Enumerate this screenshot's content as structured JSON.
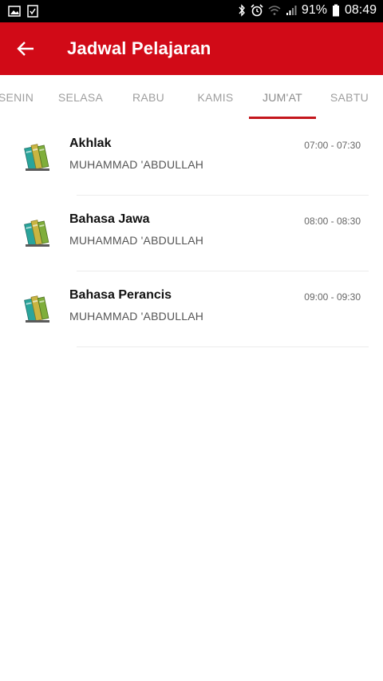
{
  "status_bar": {
    "left_icons": [
      "gallery-icon",
      "task-check-icon"
    ],
    "right_icons": [
      "bluetooth-icon",
      "alarm-icon",
      "wifi-icon",
      "signal-icon"
    ],
    "battery": "91%",
    "time": "08:49"
  },
  "app_bar": {
    "title": "Jadwal Pelajaran",
    "color": "#d10a17"
  },
  "tabs": [
    {
      "label": "SENIN"
    },
    {
      "label": "SELASA"
    },
    {
      "label": "RABU"
    },
    {
      "label": "KAMIS"
    },
    {
      "label": "JUM'AT",
      "active": true
    },
    {
      "label": "SABTU"
    }
  ],
  "schedule": [
    {
      "subject": "Akhlak",
      "teacher": "MUHAMMAD 'ABDULLAH",
      "time": "07:00 - 07:30",
      "icon": "books-icon"
    },
    {
      "subject": "Bahasa Jawa",
      "teacher": "MUHAMMAD 'ABDULLAH",
      "time": "08:00 - 08:30",
      "icon": "books-icon"
    },
    {
      "subject": "Bahasa Perancis",
      "teacher": "MUHAMMAD 'ABDULLAH",
      "time": "09:00 - 09:30",
      "icon": "books-icon"
    }
  ]
}
